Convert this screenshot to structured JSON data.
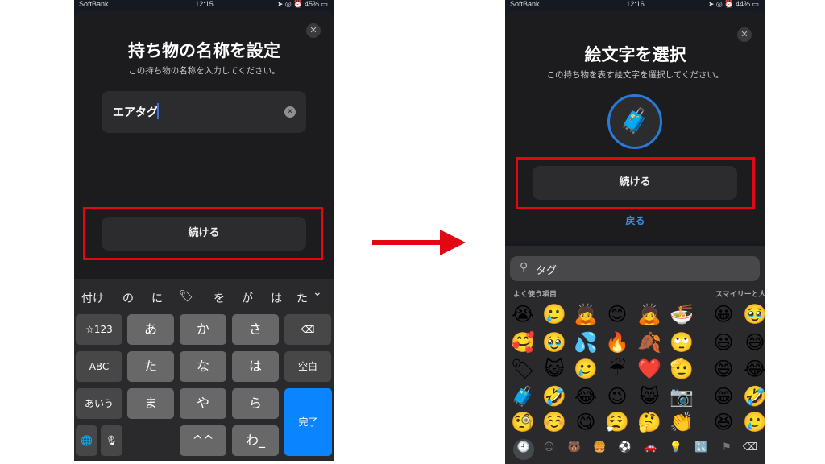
{
  "left_phone": {
    "status": {
      "carrier": "SoftBank",
      "time": "12:15",
      "battery": "45%"
    },
    "close_icon": "close-icon",
    "title": "持ち物の名称を設定",
    "subtitle": "この持ち物の名称を入力してください。",
    "name_input": {
      "value": "エアタグ"
    },
    "continue_label": "続ける",
    "candidates": [
      "付け",
      "の",
      "に",
      "🏷",
      "を",
      "が",
      "は",
      "た"
    ],
    "keys": [
      {
        "label": "☆123",
        "type": "f"
      },
      {
        "label": "あ",
        "type": "l"
      },
      {
        "label": "か",
        "type": "l"
      },
      {
        "label": "さ",
        "type": "l"
      },
      {
        "label": "⌫",
        "type": "f"
      },
      {
        "label": "ABC",
        "type": "f"
      },
      {
        "label": "た",
        "type": "l"
      },
      {
        "label": "な",
        "type": "l"
      },
      {
        "label": "は",
        "type": "l"
      },
      {
        "label": "空白",
        "type": "f"
      },
      {
        "label": "あいう",
        "type": "f"
      },
      {
        "label": "ま",
        "type": "l"
      },
      {
        "label": "や",
        "type": "l"
      },
      {
        "label": "ら",
        "type": "l"
      },
      {
        "label": "🌐",
        "type": "f"
      },
      {
        "label": "🎙",
        "type": "f"
      },
      {
        "label": "^^",
        "type": "l"
      },
      {
        "label": "わ_",
        "type": "l"
      },
      {
        "label": "、。?!",
        "type": "l"
      }
    ],
    "done_label": "完了"
  },
  "right_phone": {
    "status": {
      "carrier": "SoftBank",
      "time": "12:16",
      "battery": "44%"
    },
    "title": "絵文字を選択",
    "subtitle": "この持ち物を表す絵文字を選択してください。",
    "selected_emoji": "🧳",
    "continue_label": "続ける",
    "back_label": "戻る",
    "search": {
      "value": "タグ"
    },
    "section_frequent": "よく使う項目",
    "section_smileys": "スマイリーと人",
    "emoji_rows": [
      [
        "😭",
        "🥲",
        "🙇",
        "😊",
        "🙇",
        "🍜",
        "😀",
        "🥹"
      ],
      [
        "🥰",
        "🥹",
        "💦",
        "🔥",
        "🍂",
        "🙄",
        "😃",
        "😅"
      ],
      [
        "🏷",
        "😺",
        "🥲",
        "☔",
        "❤️",
        "🫡",
        "😄",
        "😂"
      ],
      [
        "🧳",
        "🤣",
        "😂",
        "😉",
        "😸",
        "📷",
        "😁",
        "🤣"
      ],
      [
        "🧐",
        "☺️",
        "😋",
        "😮‍💨",
        "🤔",
        "👏",
        "😆",
        "🥲"
      ]
    ],
    "categories": [
      "🕘",
      "☺",
      "🐻",
      "🍔",
      "⚽",
      "🚗",
      "💡",
      "🔣",
      "⚑",
      "⌫"
    ]
  },
  "colors": {
    "accent_blue": "#0a84ff",
    "highlight_red": "#e30613",
    "arrow_red": "#e30613"
  }
}
